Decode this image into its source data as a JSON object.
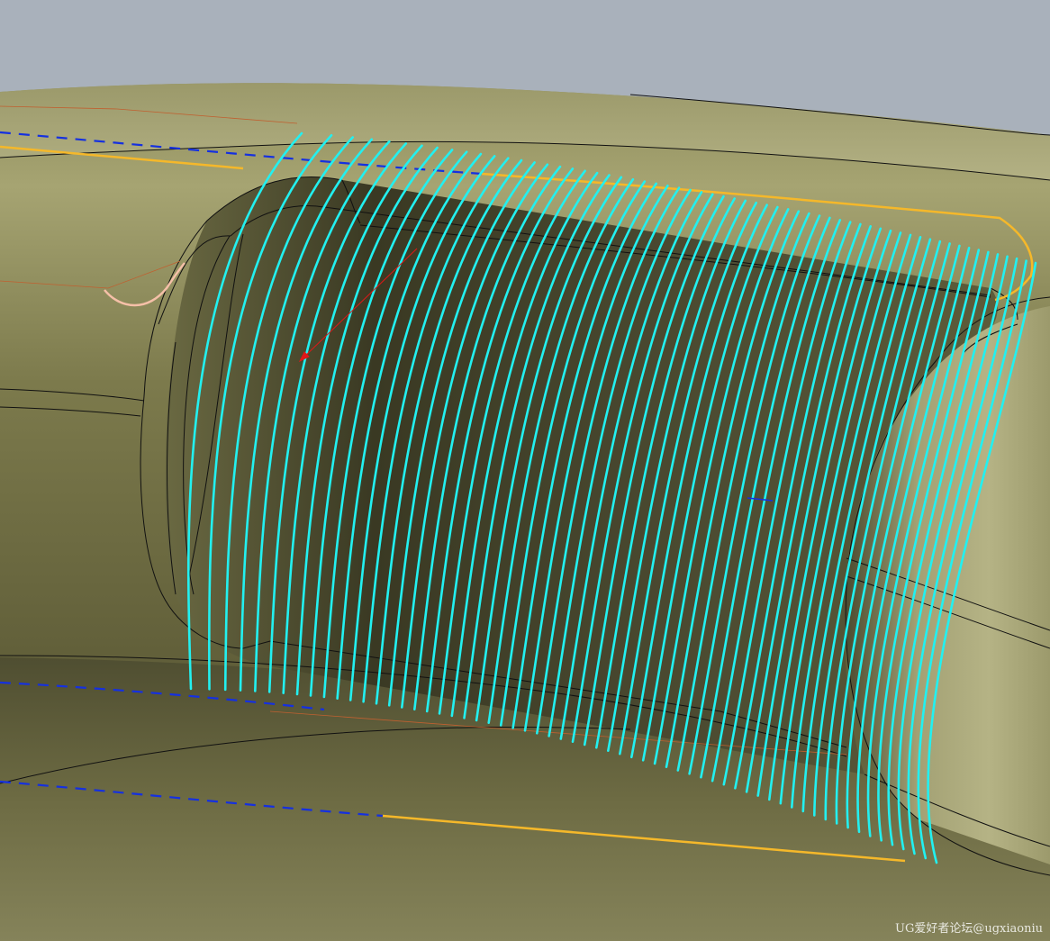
{
  "watermark": {
    "text": "UG爱好者论坛@ugxiaoniu"
  },
  "colors": {
    "background": "#a9b1bb",
    "surface_light": "#a8a676",
    "surface_dark": "#3b3a24",
    "toolpath": "#22f0f0",
    "boundary": "#f5b82a",
    "dashed": "#1530e0",
    "vector": "#e01818",
    "edge": "#111111"
  },
  "scene": {
    "toolpath_pass_count": 62
  }
}
